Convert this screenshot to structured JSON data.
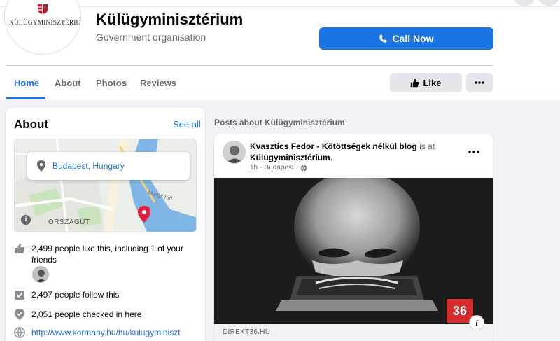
{
  "header": {
    "logo_text": "KÜLÜGYMINISZTÉRIUM",
    "page_title": "Külügyminisztérium",
    "category": "Government organisation",
    "call_button_label": "Call Now",
    "tabs": [
      {
        "label": "Home",
        "active": true
      },
      {
        "label": "About",
        "active": false
      },
      {
        "label": "Photos",
        "active": false
      },
      {
        "label": "Reviews",
        "active": false
      }
    ],
    "like_button_label": "Like",
    "more_icon": "ellipsis-icon"
  },
  "about": {
    "title": "About",
    "see_all": "See all",
    "map": {
      "location": "Budapest, Hungary",
      "district_label": "ORSZÁGÚT",
      "street_label": "Margit híd"
    },
    "likes_text": "2,499 people like this, including 1 of your friends",
    "follows_text": "2,497 people follow this",
    "checkins_text": "2,051 people checked in here",
    "website": "http://www.kormany.hu/hu/kulugyminiszt"
  },
  "feed": {
    "heading": "Posts about Külügyminisztérium",
    "post": {
      "author": "Kvasztics Fedor - Kötöttségek nélkül blog",
      "connector": "is at",
      "place": "Külügyminisztérium",
      "time": "1h",
      "location": "Budapest",
      "image_badge": "36",
      "link_source": "DIREKT36.HU"
    }
  },
  "colors": {
    "brand_blue": "#1b74e4",
    "page_bg": "#f0f2f5",
    "badge_red": "#d52b2b"
  }
}
